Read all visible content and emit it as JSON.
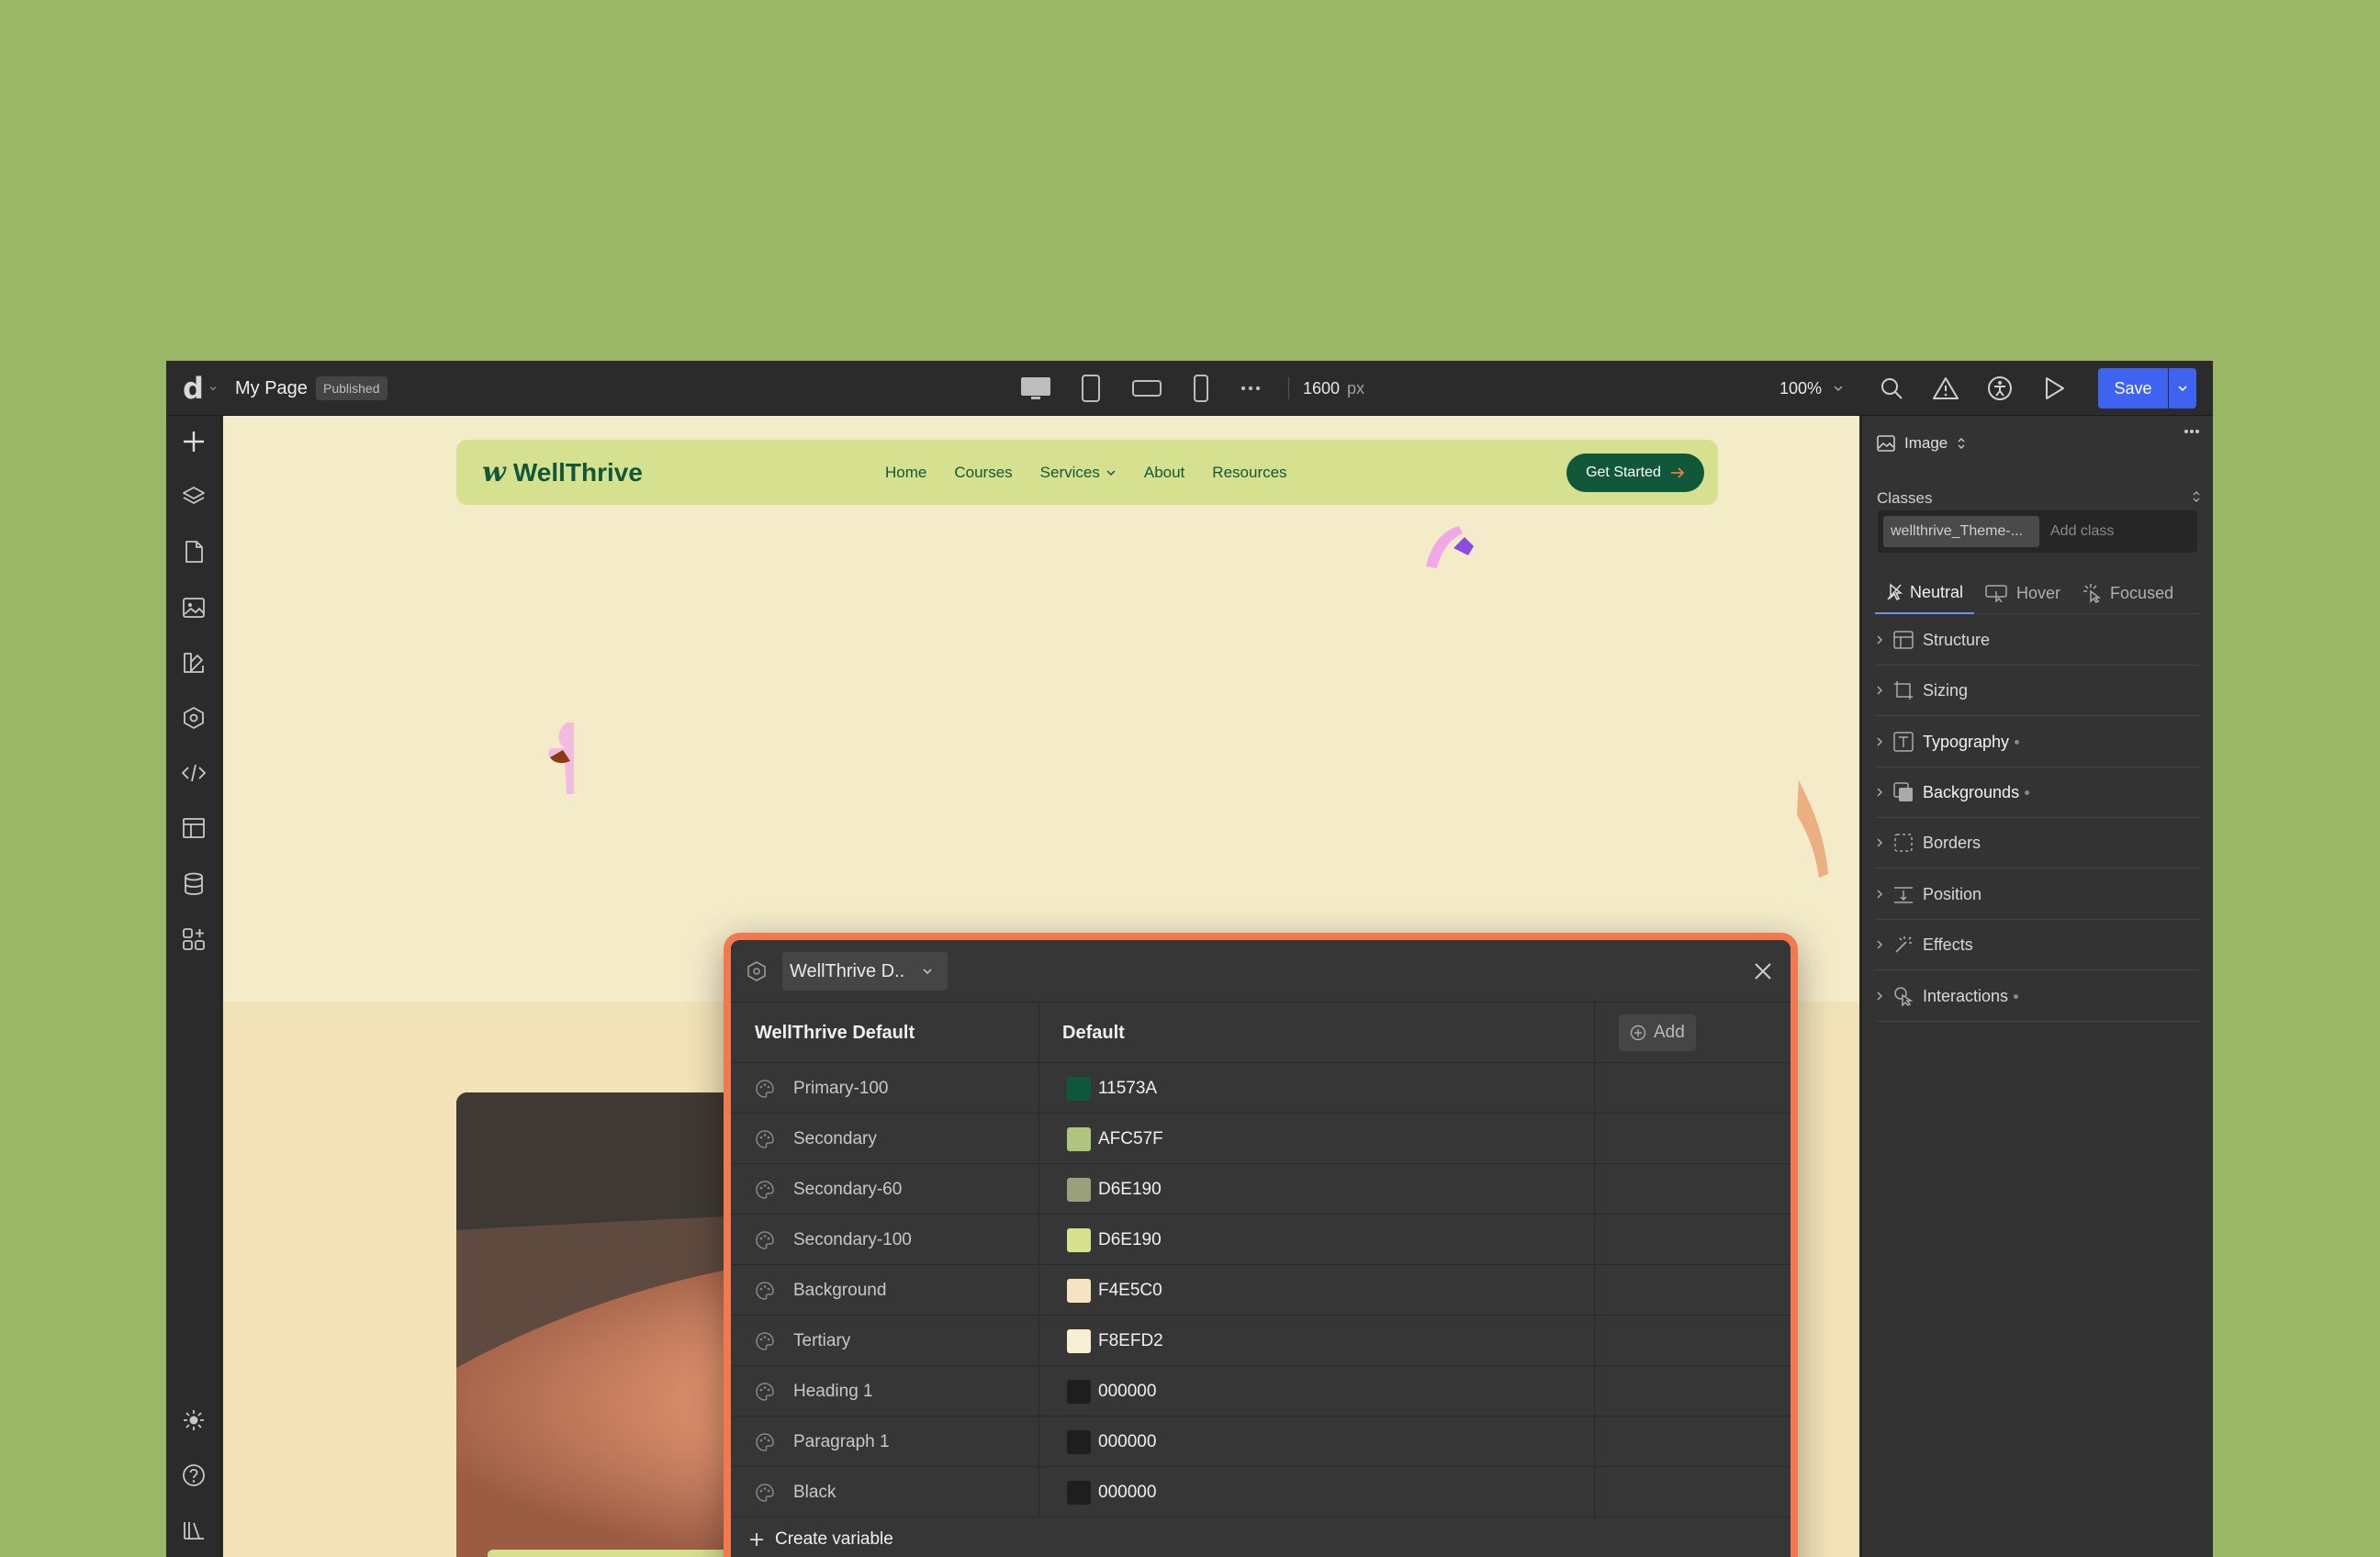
{
  "topbar": {
    "logo": "d",
    "page_name": "My Page",
    "status_badge": "Published",
    "width_value": "1600",
    "width_unit": "px",
    "zoom": "100%",
    "save_label": "Save"
  },
  "site": {
    "brand": "WellThrive",
    "brand_mark": "w",
    "nav": [
      "Home",
      "Courses",
      "Services",
      "About",
      "Resources"
    ],
    "cta": "Get Started"
  },
  "modal": {
    "collection": "WellThrive D..",
    "col_name_header": "WellThrive Default",
    "col_mode_header": "Default",
    "add_label": "Add",
    "variables": [
      {
        "name": "Primary-100",
        "value": "11573A",
        "color": "#11573A"
      },
      {
        "name": "Secondary",
        "value": "AFC57F",
        "color": "#AFC57F"
      },
      {
        "name": "Secondary-60",
        "value": "D6E190",
        "color": "#9aa07a"
      },
      {
        "name": "Secondary-100",
        "value": "D6E190",
        "color": "#D6E190"
      },
      {
        "name": "Background",
        "value": "F4E5C0",
        "color": "#F4E5C0"
      },
      {
        "name": "Tertiary",
        "value": "F8EFD2",
        "color": "#F8EFD2"
      },
      {
        "name": "Heading 1",
        "value": "000000",
        "color": "#1e1e1e"
      },
      {
        "name": "Paragraph 1",
        "value": "000000",
        "color": "#1e1e1e"
      },
      {
        "name": "Black",
        "value": "000000",
        "color": "#1e1e1e"
      }
    ],
    "create_label": "Create variable"
  },
  "right_panel": {
    "element_type": "Image",
    "classes_label": "Classes",
    "class_chip": "wellthrive_Theme-...",
    "add_class_placeholder": "Add class",
    "states": [
      "Neutral",
      "Hover",
      "Focused"
    ],
    "sections": [
      {
        "label": "Structure",
        "modified": false
      },
      {
        "label": "Sizing",
        "modified": false
      },
      {
        "label": "Typography",
        "modified": true
      },
      {
        "label": "Backgrounds",
        "modified": true
      },
      {
        "label": "Borders",
        "modified": false
      },
      {
        "label": "Position",
        "modified": false
      },
      {
        "label": "Effects",
        "modified": false
      },
      {
        "label": "Interactions",
        "modified": true
      }
    ]
  },
  "colors": {
    "accent": "#3e63f0",
    "modal_border": "#f2794f",
    "brand_green": "#11573a"
  }
}
